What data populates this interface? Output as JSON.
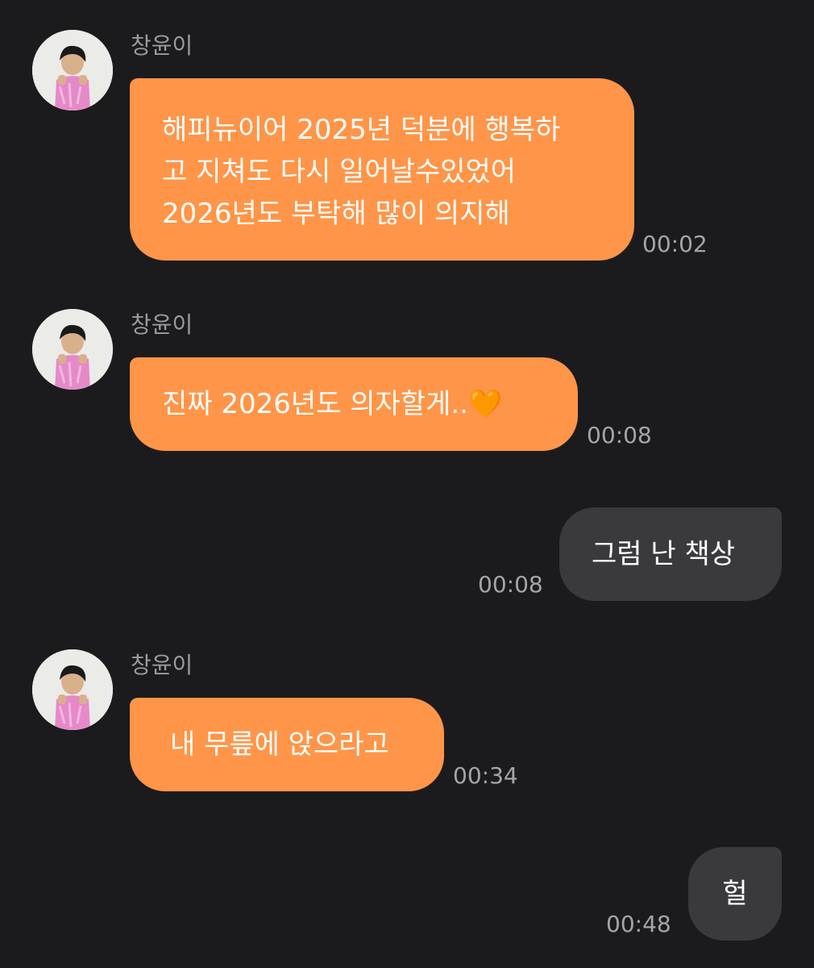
{
  "chat": {
    "messages": [
      {
        "direction": "incoming",
        "sender": "창윤이",
        "lines": [
          "해피뉴이어 2025년 덕분에 행복하",
          "고 지쳐도 다시 일어날수있었어",
          "2026년도 부탁해 많이 의지해"
        ],
        "time": "00:02"
      },
      {
        "direction": "incoming",
        "sender": "창윤이",
        "text": "진짜 2026년도 의자할게..🧡",
        "time": "00:08"
      },
      {
        "direction": "outgoing",
        "text": "그럼 난 책상",
        "time": "00:08"
      },
      {
        "direction": "incoming",
        "sender": "창윤이",
        "text": "내 무릎에 앉으라고",
        "time": "00:34"
      },
      {
        "direction": "outgoing",
        "text": "헐",
        "time": "00:48"
      }
    ]
  },
  "theme": {
    "background": "#1b1b1d",
    "incoming_bubble": "#ff9548",
    "outgoing_bubble": "#3a3a3e",
    "text": "#ffffff",
    "meta_text": "#9a9aa0"
  }
}
